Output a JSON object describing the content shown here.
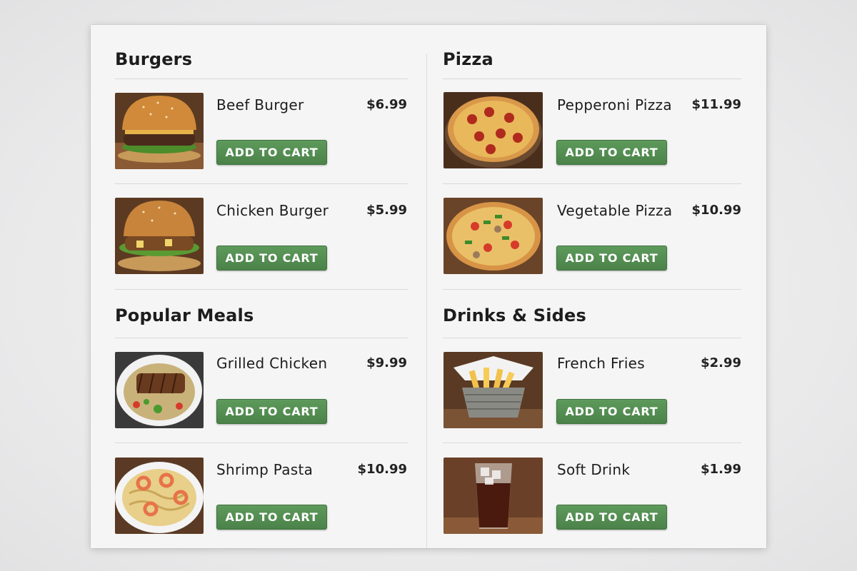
{
  "sections": {
    "burgers": {
      "title": "Burgers"
    },
    "pizza": {
      "title": "Pizza"
    },
    "popular": {
      "title": "Popular Meals"
    },
    "drinks": {
      "title": "Drinks & Sides"
    }
  },
  "items": [
    {
      "name": "Beef Burger",
      "price": "$6.99",
      "button": "ADD TO CART",
      "image": "beef-burger-photo"
    },
    {
      "name": "Chicken Burger",
      "price": "$5.99",
      "button": "ADD TO CART",
      "image": "chicken-burger-photo"
    },
    {
      "name": "Pepperoni Pizza",
      "price": "$11.99",
      "button": "ADD TO CART",
      "image": "pepperoni-pizza-photo"
    },
    {
      "name": "Vegetable Pizza",
      "price": "$10.99",
      "button": "ADD TO CART",
      "image": "vegetable-pizza-photo"
    },
    {
      "name": "Grilled Chicken",
      "price": "$9.99",
      "button": "ADD TO CART",
      "image": "grilled-chicken-photo"
    },
    {
      "name": "Shrimp Pasta",
      "price": "$10.99",
      "button": "ADD TO CART",
      "image": "shrimp-pasta-photo"
    },
    {
      "name": "French Fries",
      "price": "$2.99",
      "button": "ADD TO CART",
      "image": "french-fries-photo"
    },
    {
      "name": "Soft Drink",
      "price": "$1.99",
      "button": "ADD TO CART",
      "image": "soft-drink-photo"
    }
  ],
  "colors": {
    "button": "#4f874d",
    "panel": "#f5f5f5",
    "text": "#1d1d1d"
  }
}
